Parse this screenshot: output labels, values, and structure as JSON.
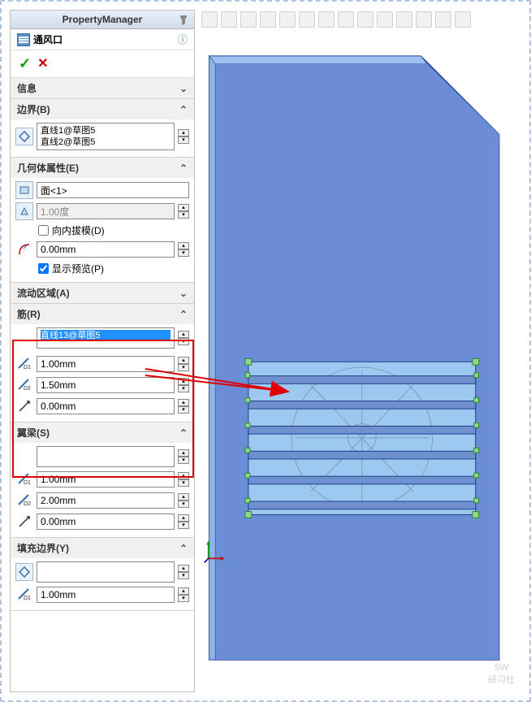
{
  "panel": {
    "title": "PropertyManager",
    "feature_name": "通风口",
    "ok_tooltip": "确定",
    "cancel_tooltip": "取消",
    "help_tooltip": "帮助"
  },
  "sections": {
    "info": {
      "title": "信息"
    },
    "boundary": {
      "title": "边界(B)",
      "items": [
        "直线1@草图5",
        "直线2@草图5"
      ]
    },
    "geometry": {
      "title": "几何体属性(E)",
      "face": "面<1>",
      "draft_angle": "1.00度",
      "draft_inward_label": "向内拔模(D)",
      "draft_inward_checked": false,
      "offset": "0.00mm",
      "show_preview_label": "显示预览(P)",
      "show_preview_checked": true
    },
    "flow_area": {
      "title": "流动区域(A)"
    },
    "ribs": {
      "title": "筋(R)",
      "selected_item": "直线13@草图5",
      "d1": "1.00mm",
      "d2": "1.50mm",
      "offset": "0.00mm"
    },
    "spars": {
      "title": "翼梁(S)",
      "d1": "1.00mm",
      "d2": "2.00mm",
      "offset": "0.00mm"
    },
    "fill_boundary": {
      "title": "填充边界(Y)",
      "d1": "1.00mm"
    }
  },
  "watermark": {
    "line1": "SW",
    "line2": "研习社"
  }
}
